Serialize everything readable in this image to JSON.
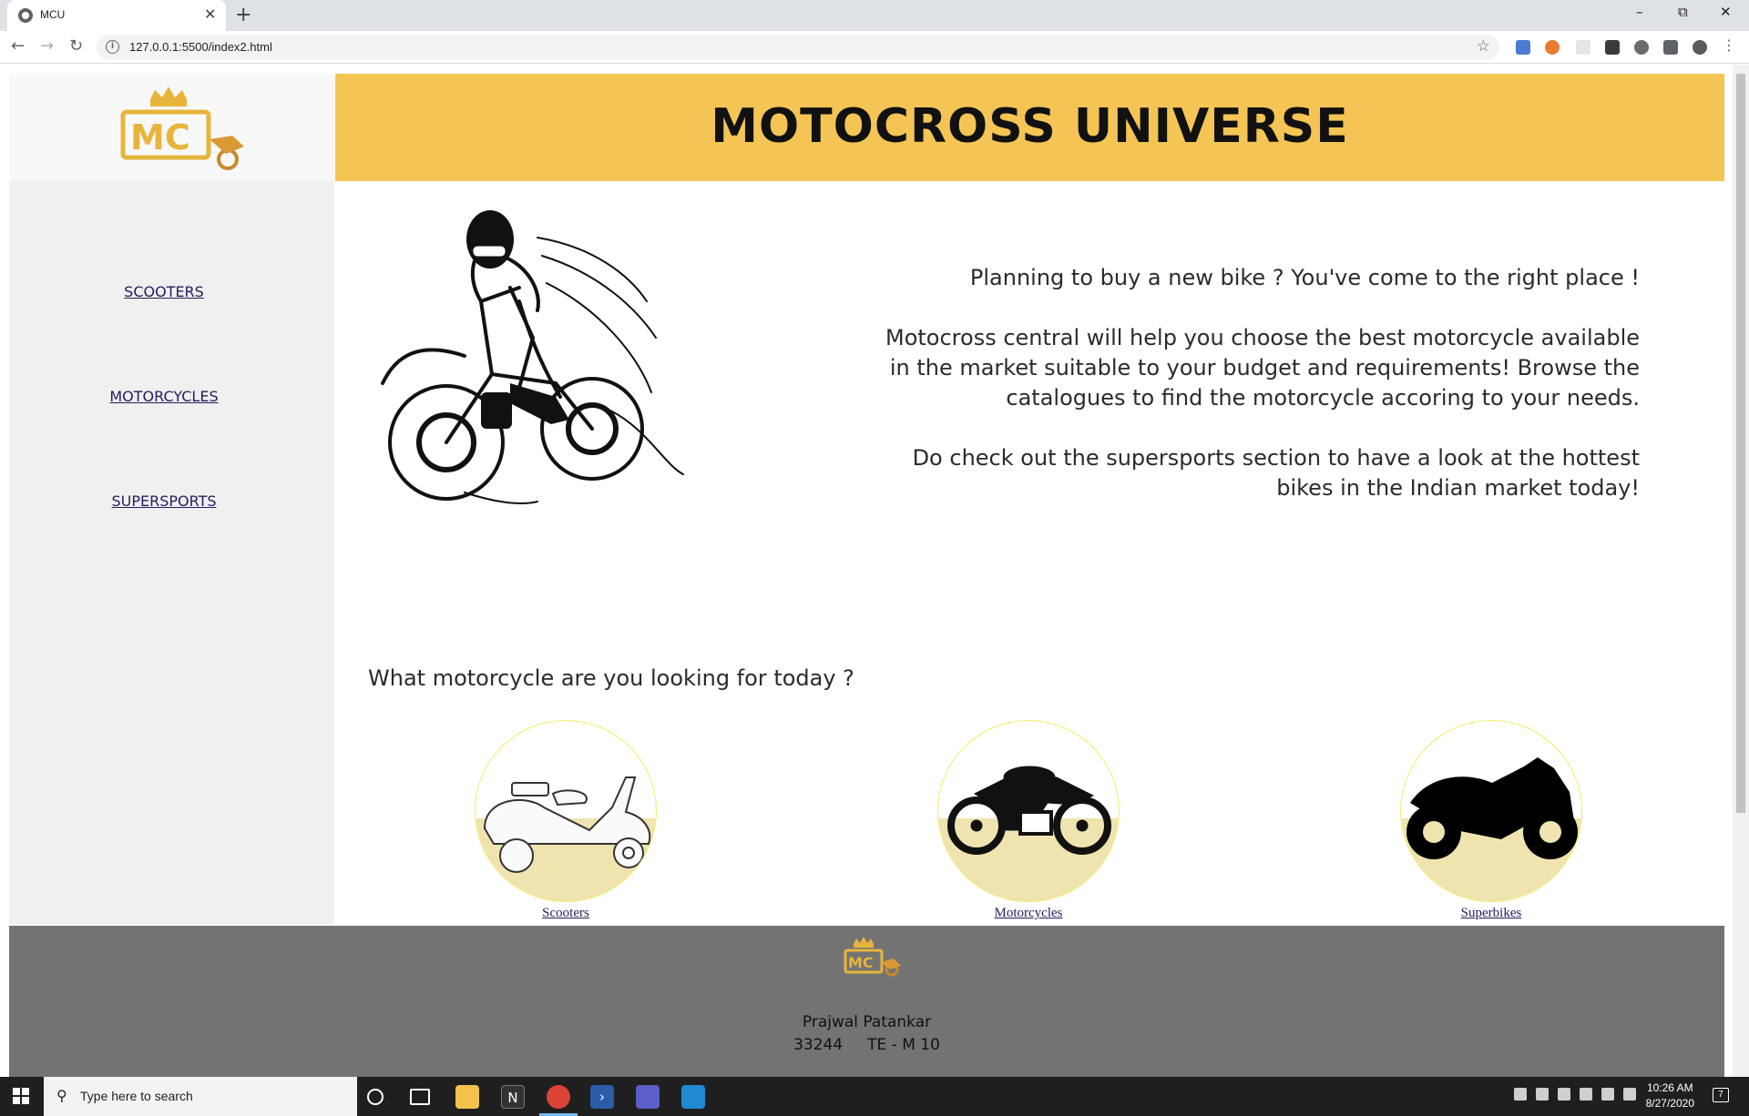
{
  "browser": {
    "tab_title": "MCU",
    "close_tab": "✕",
    "new_tab": "+",
    "url": "127.0.0.1:5500/index2.html"
  },
  "site": {
    "title": "MOTOCROSS UNIVERSE",
    "nav": [
      "SCOOTERS",
      "MOTORCYCLES",
      "SUPERSPORTS"
    ],
    "intro": [
      "Planning to buy a new bike ? You've come to the right place !",
      "Motocross central will help you choose the best motorcycle available in the market suitable to your budget and requirements! Browse the catalogues to find the motorcycle accoring to your needs.",
      "Do check out the supersports section to have a look at the hottest bikes in the Indian market today!"
    ],
    "question": "What motorcycle are you looking for today ?",
    "categories": [
      {
        "label": "Scooters"
      },
      {
        "label": "Motorcycles"
      },
      {
        "label": "Superbikes"
      }
    ],
    "footer": {
      "name": "Prajwal Patankar",
      "roll": "33244     TE - M 10"
    },
    "colors": {
      "header": "#f4c554",
      "logo_gold": "#e8b53c",
      "footer": "#737373"
    }
  },
  "taskbar": {
    "search_placeholder": "Type here to search",
    "time": "10:26 AM",
    "date": "8/27/2020",
    "notification_count": "7"
  }
}
